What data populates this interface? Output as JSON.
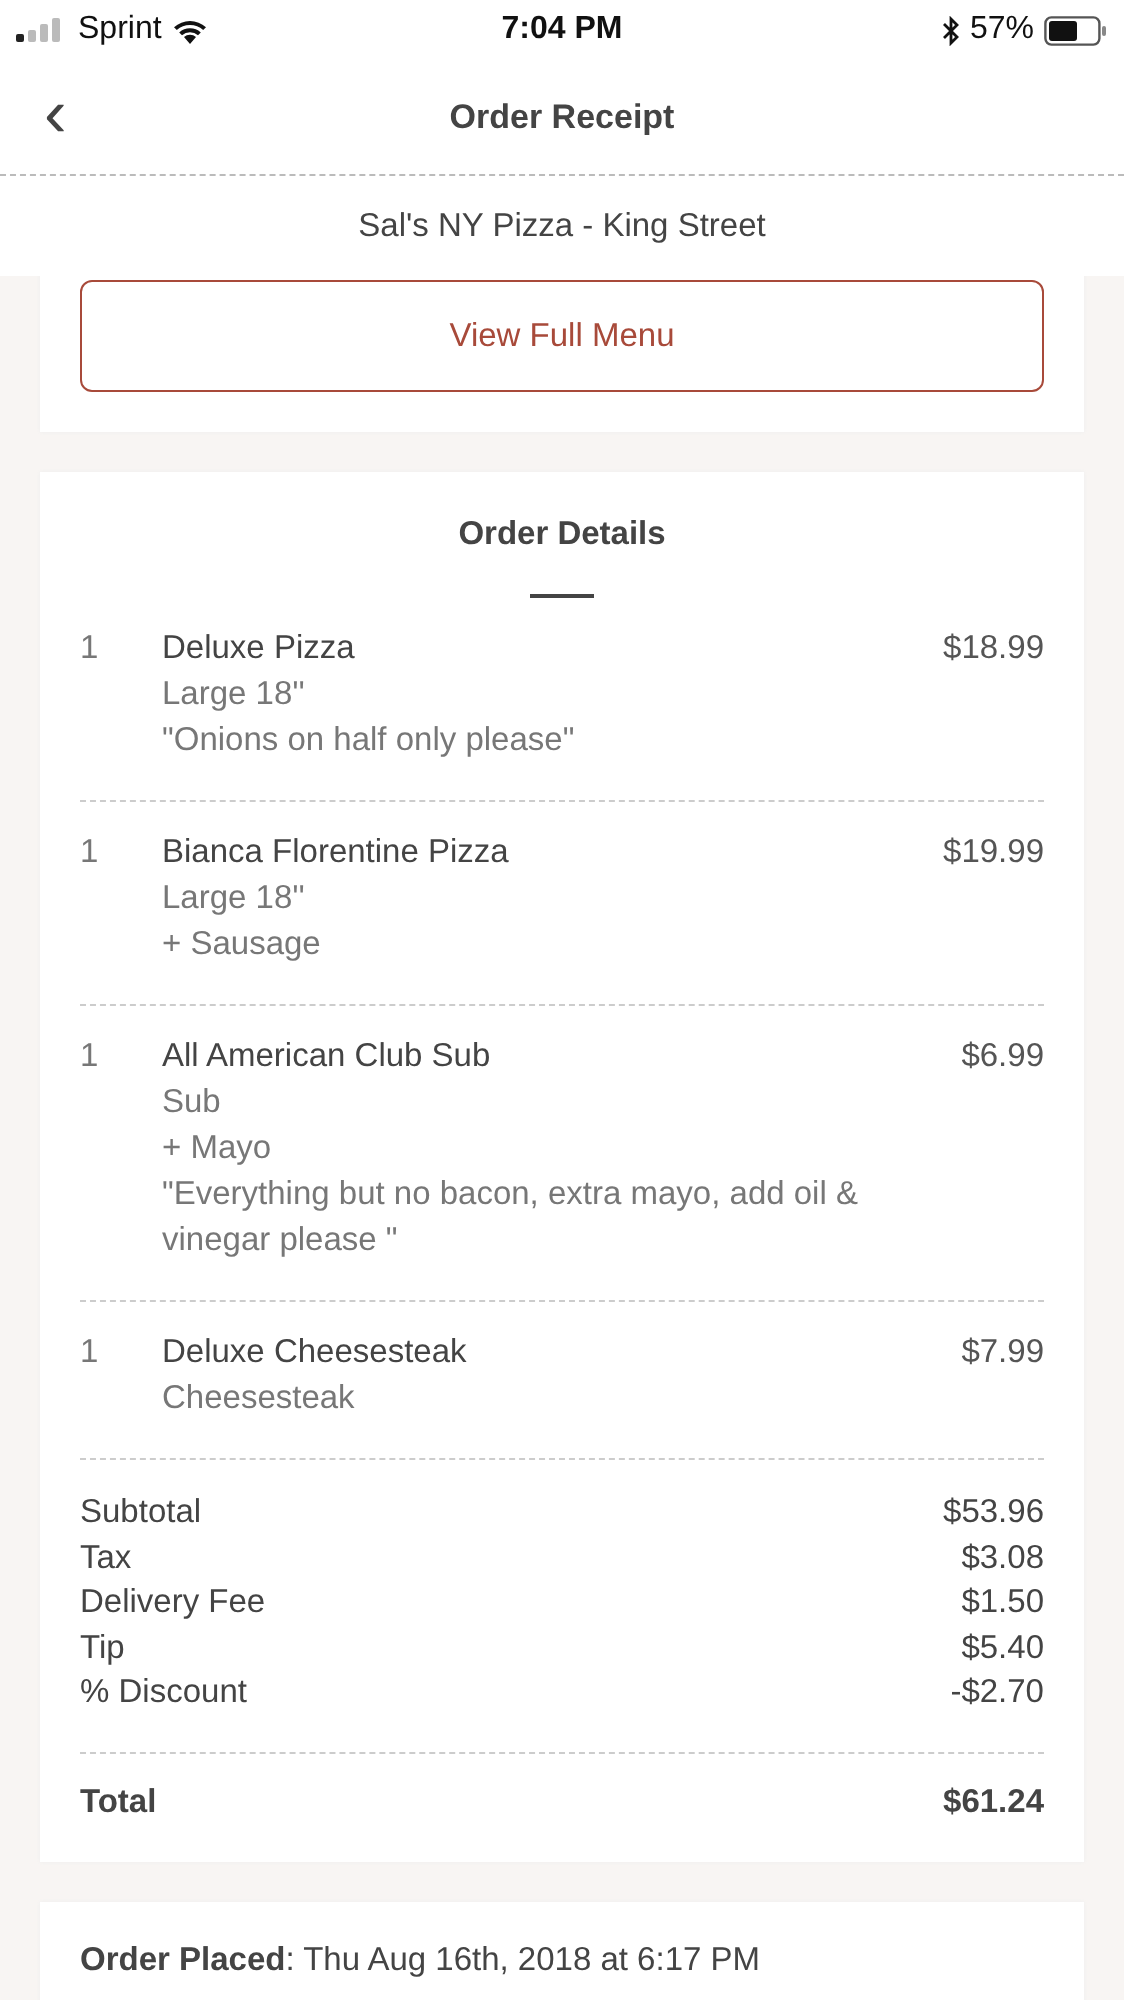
{
  "status_bar": {
    "carrier": "Sprint",
    "time": "7:04 PM",
    "battery": "57%"
  },
  "header": {
    "back": "‹",
    "title": "Order Receipt"
  },
  "restaurant": "Sal's NY Pizza - King Street",
  "menu_button": "View Full Menu",
  "order_details": {
    "title": "Order Details",
    "items": [
      {
        "qty": "1",
        "name": "Deluxe Pizza",
        "price": "$18.99",
        "details": [
          "Large 18''",
          "\"Onions on half only please\""
        ]
      },
      {
        "qty": "1",
        "name": "Bianca Florentine Pizza",
        "price": "$19.99",
        "details": [
          "Large 18''",
          "+ Sausage"
        ]
      },
      {
        "qty": "1",
        "name": "All American Club Sub",
        "price": "$6.99",
        "details": [
          "Sub",
          "+ Mayo",
          "\"Everything but no bacon, extra mayo, add oil & vinegar please \""
        ]
      },
      {
        "qty": "1",
        "name": "Deluxe Cheesesteak",
        "price": "$7.99",
        "details": [
          "Cheesesteak"
        ]
      }
    ],
    "summary": [
      {
        "label": "Subtotal",
        "value": "$53.96"
      },
      {
        "label": "Tax",
        "value": "$3.08"
      },
      {
        "label": "Delivery Fee",
        "value": "$1.50"
      },
      {
        "label": "Tip",
        "value": "$5.40"
      },
      {
        "label": "% Discount",
        "value": "-$2.70"
      }
    ],
    "total": {
      "label": "Total",
      "value": "$61.24"
    }
  },
  "order_placed": "**Order Placed**: Thu Aug 16th, 2018 at 6:17 PM"
}
